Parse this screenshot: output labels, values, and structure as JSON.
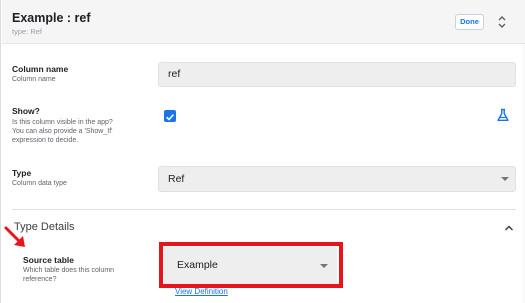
{
  "header": {
    "title": "Example : ref",
    "subtitle": "type: Ref",
    "done_label": "Done"
  },
  "fields": {
    "column_name": {
      "label": "Column name",
      "help": "Column name",
      "value": "ref"
    },
    "show": {
      "label": "Show?",
      "help_lines": [
        "Is this column visible in the app?",
        "You can also provide a 'Show_If'",
        "expression to decide."
      ],
      "checked": true
    },
    "type": {
      "label": "Type",
      "help": "Column data type",
      "value": "Ref"
    }
  },
  "type_details": {
    "section_title": "Type Details",
    "source_table": {
      "label": "Source table",
      "help_lines": [
        "Which table does this column",
        "reference?"
      ],
      "value": "Example",
      "view_definition_label": "View Definition"
    }
  },
  "colors": {
    "accent": "#1a73e8",
    "highlight": "#e8141c",
    "header_bg": "#f5f5f5",
    "input_bg": "#eeeeee"
  },
  "icons": {
    "updown": "unfold-icon",
    "flask": "flask-icon",
    "chevron": "chevron-up-icon",
    "select": "chevron-down-icon"
  }
}
